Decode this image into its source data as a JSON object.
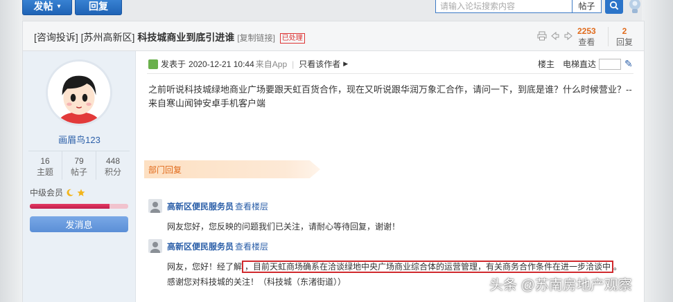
{
  "toolbar": {
    "post_label": "发帖",
    "post_dropdown": "▾",
    "reply_label": "回复",
    "search_placeholder": "请输入论坛搜索内容",
    "search_type": "帖子",
    "search_icon": "search-icon",
    "decor_icon": "lightbulb-icon"
  },
  "thread": {
    "category1": "[咨询投诉]",
    "category2": "[苏州高新区]",
    "title": "科技城商业到底引进谁",
    "copy_link": "[复制链接]",
    "status_badge": "已处理",
    "views_num": "2253",
    "views_label": "查看",
    "replies_num": "2",
    "replies_label": "回复"
  },
  "author": {
    "name": "画眉鸟123",
    "topics_num": "16",
    "topics_label": "主题",
    "posts_num": "79",
    "posts_label": "帖子",
    "points_num": "448",
    "points_label": "积分",
    "rank": "中级会员",
    "rank_progress_pct": 81,
    "message_button": "发消息"
  },
  "post": {
    "posted_prefix": "发表于",
    "posted_time": "2020-12-21 10:44",
    "from_app": "来自App",
    "only_author": "只看该作者",
    "floor_label": "楼主",
    "jump_label": "电梯直达",
    "body": "之前听说科技城绿地商业广场要跟天虹百货合作，现在又听说跟华润万象汇合作，请问一下，到底是谁？什么时候营业？--来自寒山闻钟安卓手机客户端"
  },
  "dept": {
    "label": "部门回复"
  },
  "replies": [
    {
      "name": "高新区便民服务员",
      "view": "查看楼层",
      "text": "网友您好，您反映的问题我们已关注，请耐心等待回复，谢谢！"
    },
    {
      "name": "高新区便民服务员",
      "view": "查看楼层",
      "text_before": "网友，您好！经了解",
      "text_highlight": "，目前天虹商场确系在洽谈绿地中央广场商业综合体的运营管理，有关商务合作条件在进一步洽谈中",
      "text_after": "。感谢您对科技城的关注！（科技城（东渚街道））"
    }
  ],
  "watermark": "头条 @苏南房地产观察",
  "colors": {
    "accent_blue": "#2b74c9",
    "link_blue": "#2a5ea8",
    "orange": "#e06a1b",
    "highlight_red": "#d0292d"
  }
}
